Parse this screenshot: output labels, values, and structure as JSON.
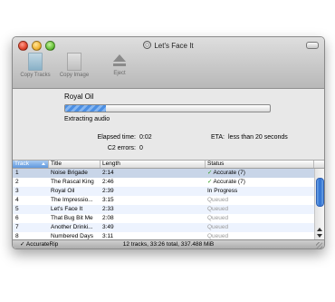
{
  "window": {
    "title": "Let's Face It"
  },
  "toolbar": {
    "copy_tracks_label": "Copy Tracks",
    "copy_image_label": "Copy Image",
    "eject_label": "Eject"
  },
  "rip": {
    "album": "Royal Oil",
    "progress_fraction": 0.2,
    "status": "Extracting audio",
    "elapsed_label": "Elapsed time:",
    "elapsed_value": "0:02",
    "eta_label": "ETA:",
    "eta_value": "less than 20 seconds",
    "c2_label": "C2 errors:",
    "c2_value": "0"
  },
  "table": {
    "columns": {
      "track": "Track",
      "title": "Title",
      "length": "Length",
      "status": "Status"
    },
    "rows": [
      {
        "track": "1",
        "title": "Noise Brigade",
        "length": "2:14",
        "status": "Accurate (7)",
        "state": "accurate"
      },
      {
        "track": "2",
        "title": "The Rascal King",
        "length": "2:46",
        "status": "Accurate (7)",
        "state": "accurate"
      },
      {
        "track": "3",
        "title": "Royal Oil",
        "length": "2:39",
        "status": "In Progress",
        "state": "progress"
      },
      {
        "track": "4",
        "title": "The Impressio...",
        "length": "3:15",
        "status": "Queued",
        "state": "queued"
      },
      {
        "track": "5",
        "title": "Let's Face It",
        "length": "2:33",
        "status": "Queued",
        "state": "queued"
      },
      {
        "track": "6",
        "title": "That Bug Bit Me",
        "length": "2:08",
        "status": "Queued",
        "state": "queued"
      },
      {
        "track": "7",
        "title": "Another Drinki...",
        "length": "3:49",
        "status": "Queued",
        "state": "queued"
      },
      {
        "track": "8",
        "title": "Numbered Days",
        "length": "3:11",
        "status": "Queued",
        "state": "queued"
      }
    ]
  },
  "statusbar": {
    "accuraterip": "✓ AccurateRip",
    "summary": "12 tracks, 33:26 total, 337.488 MiB"
  },
  "colors": {
    "accurate_check": "#2f9a1e",
    "progress_fill": "#4c8fe3",
    "selection": "#c8d5e8"
  },
  "icons": {
    "copy_tracks": "music-document-icon",
    "copy_image": "disc-image-icon",
    "eject": "eject-icon",
    "accurate": "checkmark-icon"
  }
}
